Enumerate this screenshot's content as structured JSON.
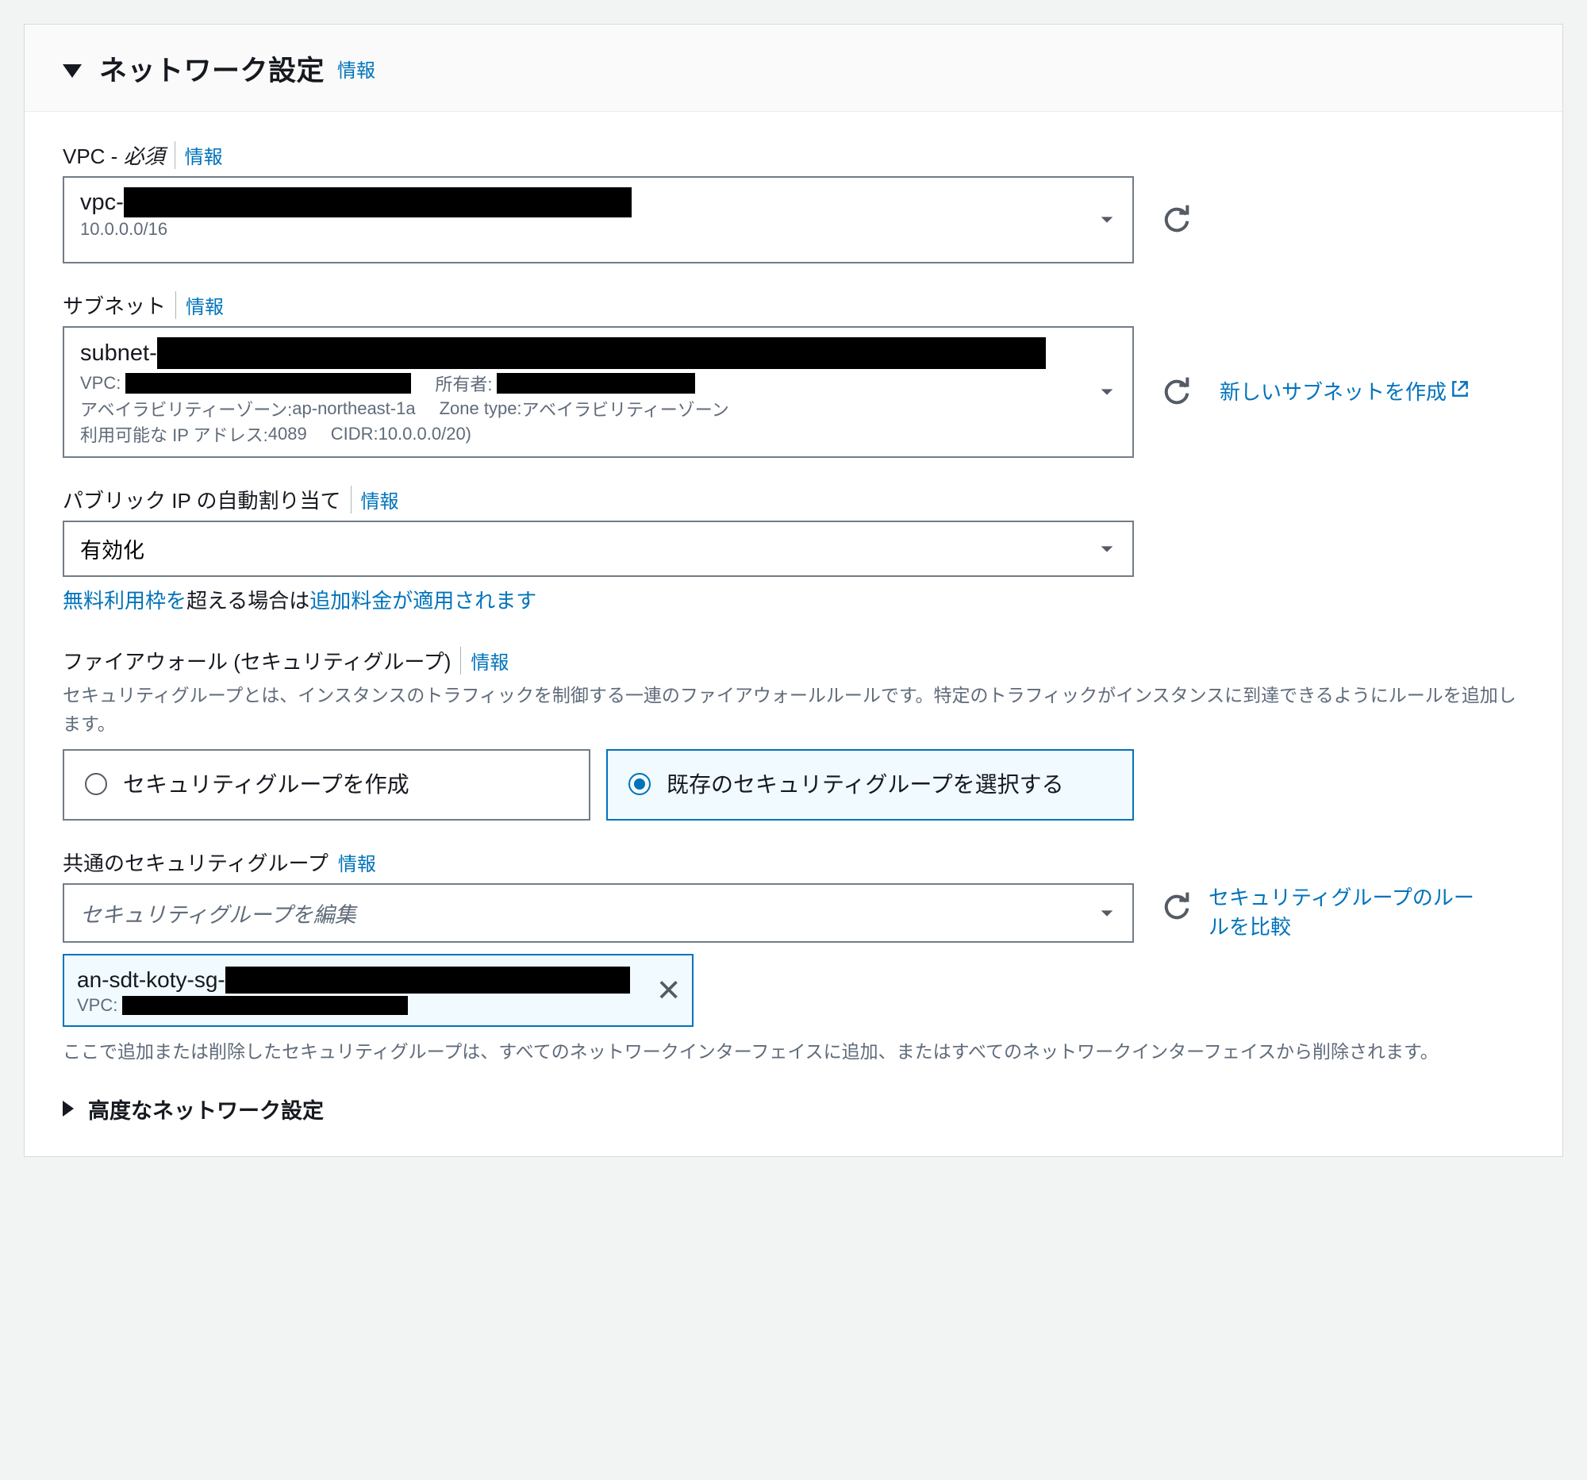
{
  "header": {
    "title": "ネットワーク設定",
    "info": "情報"
  },
  "vpc": {
    "label": "VPC - ",
    "required": "必須",
    "info": "情報",
    "value_prefix": "vpc-",
    "cidr": "10.0.0.0/16"
  },
  "subnet": {
    "label": "サブネット",
    "info": "情報",
    "value_prefix": "subnet-",
    "line2_vpc_label": "VPC:",
    "line2_owner_label": "所有者:",
    "line3_az_label": "アベイラビリティーゾーン: ",
    "line3_az_value": "ap-northeast-1a",
    "line3_zone_type_label": "Zone type: ",
    "line3_zone_type_value": "アベイラビリティーゾーン",
    "line4_ip_label": "利用可能な IP アドレス: ",
    "line4_ip_value": "4089",
    "line4_cidr_label": "CIDR: ",
    "line4_cidr_value": "10.0.0.0/20)",
    "create_link": "新しいサブネットを作成"
  },
  "public_ip": {
    "label": "パブリック IP の自動割り当て",
    "info": "情報",
    "value": "有効化",
    "note_link1": "無料利用枠を",
    "note_plain": "超える場合は",
    "note_link2": "追加料金が適用されます"
  },
  "firewall": {
    "label": "ファイアウォール (セキュリティグループ)",
    "info": "情報",
    "desc": "セキュリティグループとは、インスタンスのトラフィックを制御する一連のファイアウォールルールです。特定のトラフィックがインスタンスに到達できるようにルールを追加します。",
    "option_create": "セキュリティグループを作成",
    "option_existing": "既存のセキュリティグループを選択する"
  },
  "common_sg": {
    "label": "共通のセキュリティグループ",
    "info": "情報",
    "placeholder": "セキュリティグループを編集",
    "compare_link": "セキュリティグループのルールを比較",
    "token_prefix": "an-sdt-koty-sg-",
    "token_vpc_label": "VPC:",
    "footer": "ここで追加または削除したセキュリティグループは、すべてのネットワークインターフェイスに追加、またはすべてのネットワークインターフェイスから削除されます。"
  },
  "advanced": {
    "label": "高度なネットワーク設定"
  }
}
